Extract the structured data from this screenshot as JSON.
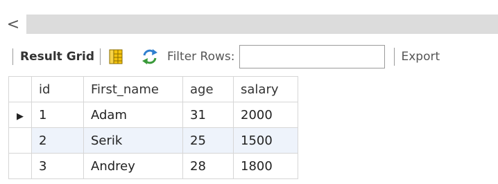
{
  "scrollbar": {
    "left_arrow": "<"
  },
  "toolbar": {
    "result_grid_label": "Result Grid",
    "filter_rows_label": "Filter Rows:",
    "filter_value": "",
    "export_label": "Export"
  },
  "grid": {
    "columns": [
      "id",
      "First_name",
      "age",
      "salary"
    ],
    "rows": [
      {
        "id": "1",
        "first_name": "Adam",
        "age": "31",
        "salary": "2000"
      },
      {
        "id": "2",
        "first_name": "Serik",
        "age": "25",
        "salary": "1500"
      },
      {
        "id": "3",
        "first_name": "Andrey",
        "age": "28",
        "salary": "1800"
      }
    ],
    "current_row_marker": "▶"
  },
  "colors": {
    "alt_row": "#eef3fb",
    "border": "#d6d6d6",
    "scroll_track": "#dcdcdc"
  },
  "icons": {
    "grid": "grid-icon",
    "refresh": "refresh-icon"
  }
}
